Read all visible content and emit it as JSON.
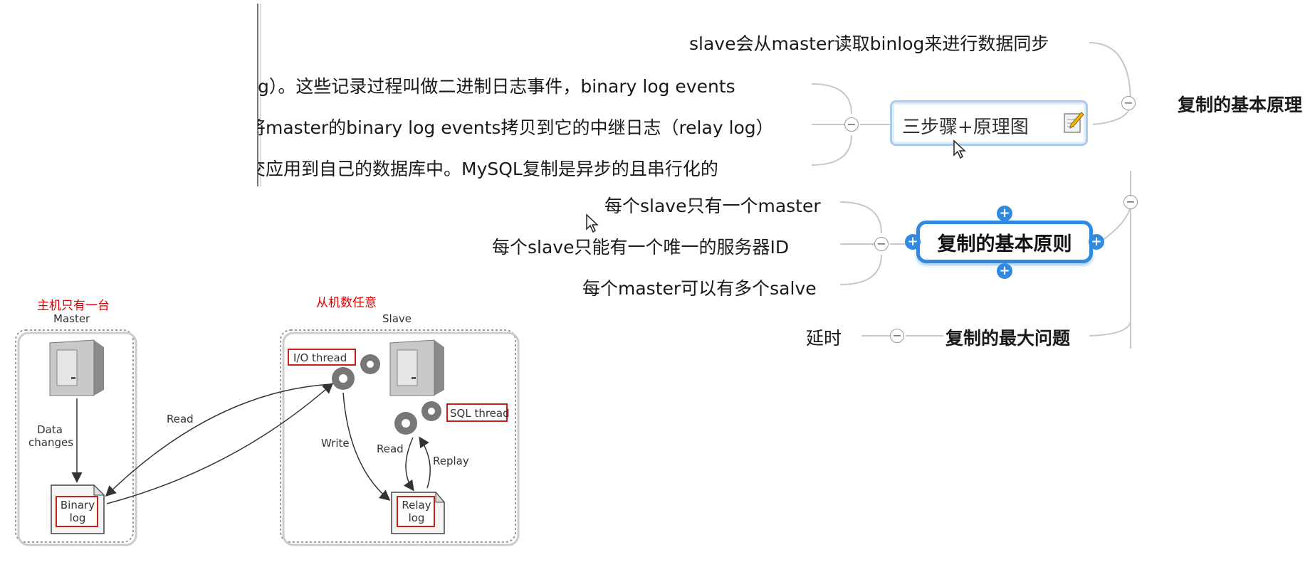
{
  "mindmap": {
    "root_label": "复制的基本原理",
    "steps_node": "三步骤+原理图",
    "steps_lines": [
      "slave会从master读取binlog来进行数据同步",
      "g）。这些记录过程叫做二进制日志事件，binary log events",
      "将master的binary log events拷贝到它的中继日志（relay log）",
      "交应用到自己的数据库中。MySQL复制是异步的且串行化的"
    ],
    "principle_node": "复制的基本原则",
    "principle_children": [
      "每个slave只有一个master",
      "每个slave只能有一个唯一的服务器ID",
      "每个master可以有多个salve"
    ],
    "problem_node": "复制的最大问题",
    "problem_child": "延时",
    "collapse_symbol": "−",
    "add_symbol": "+",
    "edit_icon": "edit-note-icon"
  },
  "replication_diagram": {
    "annotation_master": "主机只有一台",
    "annotation_slave": "从机数任意",
    "master_title": "Master",
    "slave_title": "Slave",
    "data_changes": "Data changes",
    "binary_log": "Binary log",
    "read_label": "Read",
    "io_thread": "I/O thread",
    "write_label": "Write",
    "read_label_slave": "Read",
    "replay_label": "Replay",
    "sql_thread": "SQL thread",
    "relay_log": "Relay log",
    "server_icon": "server-icon",
    "gear_icon": "gear-icon",
    "document_icon": "document-icon",
    "accent_red": "#e00000",
    "node_blue": "#2f8ae0"
  }
}
